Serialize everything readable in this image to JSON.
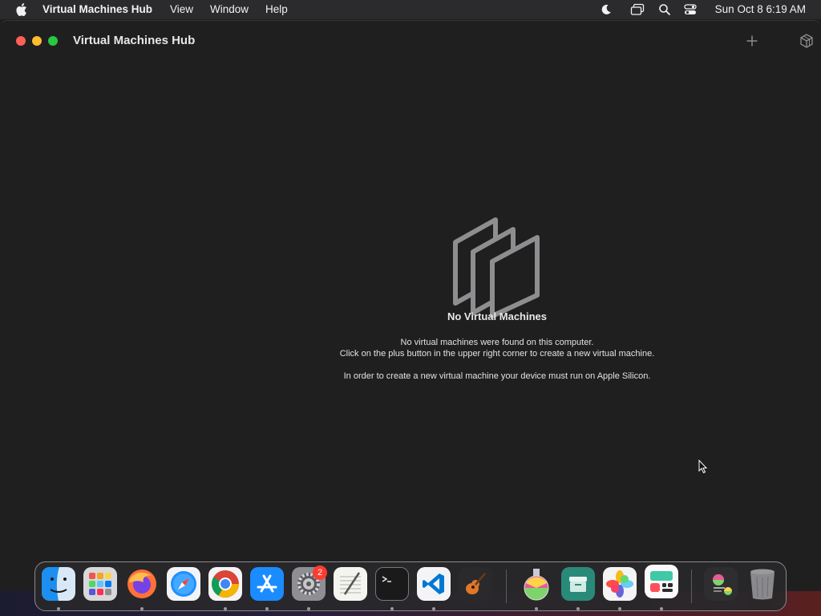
{
  "menubar": {
    "app_name": "Virtual Machines Hub",
    "menus": [
      "View",
      "Window",
      "Help"
    ],
    "clock": "Sun Oct 8  6:19 AM",
    "status_icons": [
      "moon-icon",
      "screen-mirroring-icon",
      "search-icon",
      "control-center-icon"
    ]
  },
  "window": {
    "title": "Virtual Machines Hub",
    "toolbar": [
      "plus-icon",
      "cube-icon"
    ]
  },
  "empty_state": {
    "title": "No Virtual Machines",
    "line1": "No virtual machines were found on this computer.",
    "line2": "Click on the plus button in the upper right corner to create a new virtual machine.",
    "line3": "In order to create a new virtual machine your device must run on Apple Silicon."
  },
  "dock": {
    "apps": [
      "Finder",
      "Launchpad",
      "Firefox",
      "Safari",
      "Chrome",
      "App Store",
      "System Settings",
      "TextEdit",
      "Terminal",
      "Visual Studio Code",
      "GarageBand",
      "Potion",
      "Archive",
      "Photos",
      "Widgets",
      "Stack",
      "Trash"
    ],
    "settings_badge": "2"
  },
  "colors": {
    "window_bg": "#1f1f20",
    "close": "#fe5f57",
    "minimize": "#febc2e",
    "maximize": "#28c840"
  }
}
